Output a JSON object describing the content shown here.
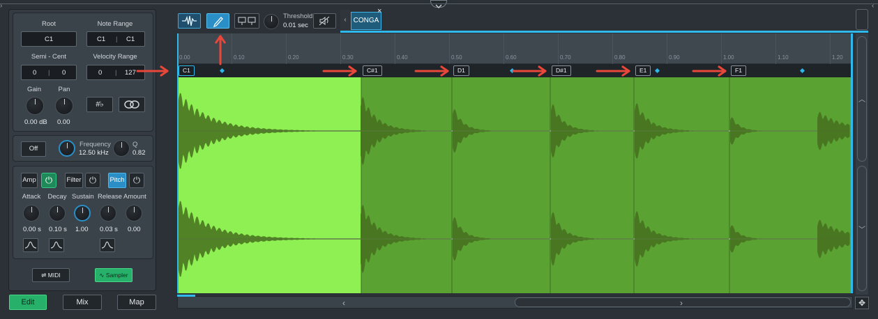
{
  "instrument": {
    "root_label": "Root",
    "root_value": "C1",
    "note_range_label": "Note Range",
    "note_range_low": "C1",
    "note_range_high": "C1",
    "semi_cent_label": "Semi - Cent",
    "semi_value": "0",
    "cent_value": "0",
    "velocity_range_label": "Velocity Range",
    "velocity_low": "0",
    "velocity_high": "127",
    "gain_label": "Gain",
    "gain_value": "0.00 dB",
    "pan_label": "Pan",
    "pan_value": "0.00",
    "sharp_flat_symbol": "#♭"
  },
  "filter_section": {
    "off_label": "Off",
    "frequency_label": "Frequency",
    "frequency_value": "12.50 kHz",
    "q_label": "Q",
    "q_value": "0.82"
  },
  "envelope": {
    "amp_label": "Amp",
    "filter_label": "Filter",
    "pitch_label": "Pitch",
    "params": [
      {
        "label": "Attack",
        "value": "0.00 s"
      },
      {
        "label": "Decay",
        "value": "0.10 s"
      },
      {
        "label": "Sustain",
        "value": "1.00"
      },
      {
        "label": "Release",
        "value": "0.03 s"
      },
      {
        "label": "Amount",
        "value": "0.00"
      }
    ]
  },
  "mode_buttons": {
    "midi": "MIDI",
    "sampler": "Sampler"
  },
  "bottom_tabs": [
    "Edit",
    "Mix",
    "Map"
  ],
  "toolbar": {
    "threshold_label": "Threshold",
    "threshold_value": "0.01 sec",
    "sample_tab": "CONGA ...",
    "close_glyph": "×"
  },
  "ruler_ticks": [
    "0.00",
    "0.10",
    "0.20",
    "0.30",
    "0.40",
    "0.50",
    "0.60",
    "0.70",
    "0.80",
    "0.90",
    "1.00",
    "1.10",
    "1.20"
  ],
  "slices": [
    "C1",
    "C#1",
    "D1",
    "D#1",
    "E1",
    "F1"
  ],
  "colors": {
    "accent_blue": "#2eb8ec",
    "wave_bright": "#8ef052",
    "wave_dark": "#5aa232",
    "arrow_red": "#e8473a",
    "active_green": "#27b06a"
  }
}
